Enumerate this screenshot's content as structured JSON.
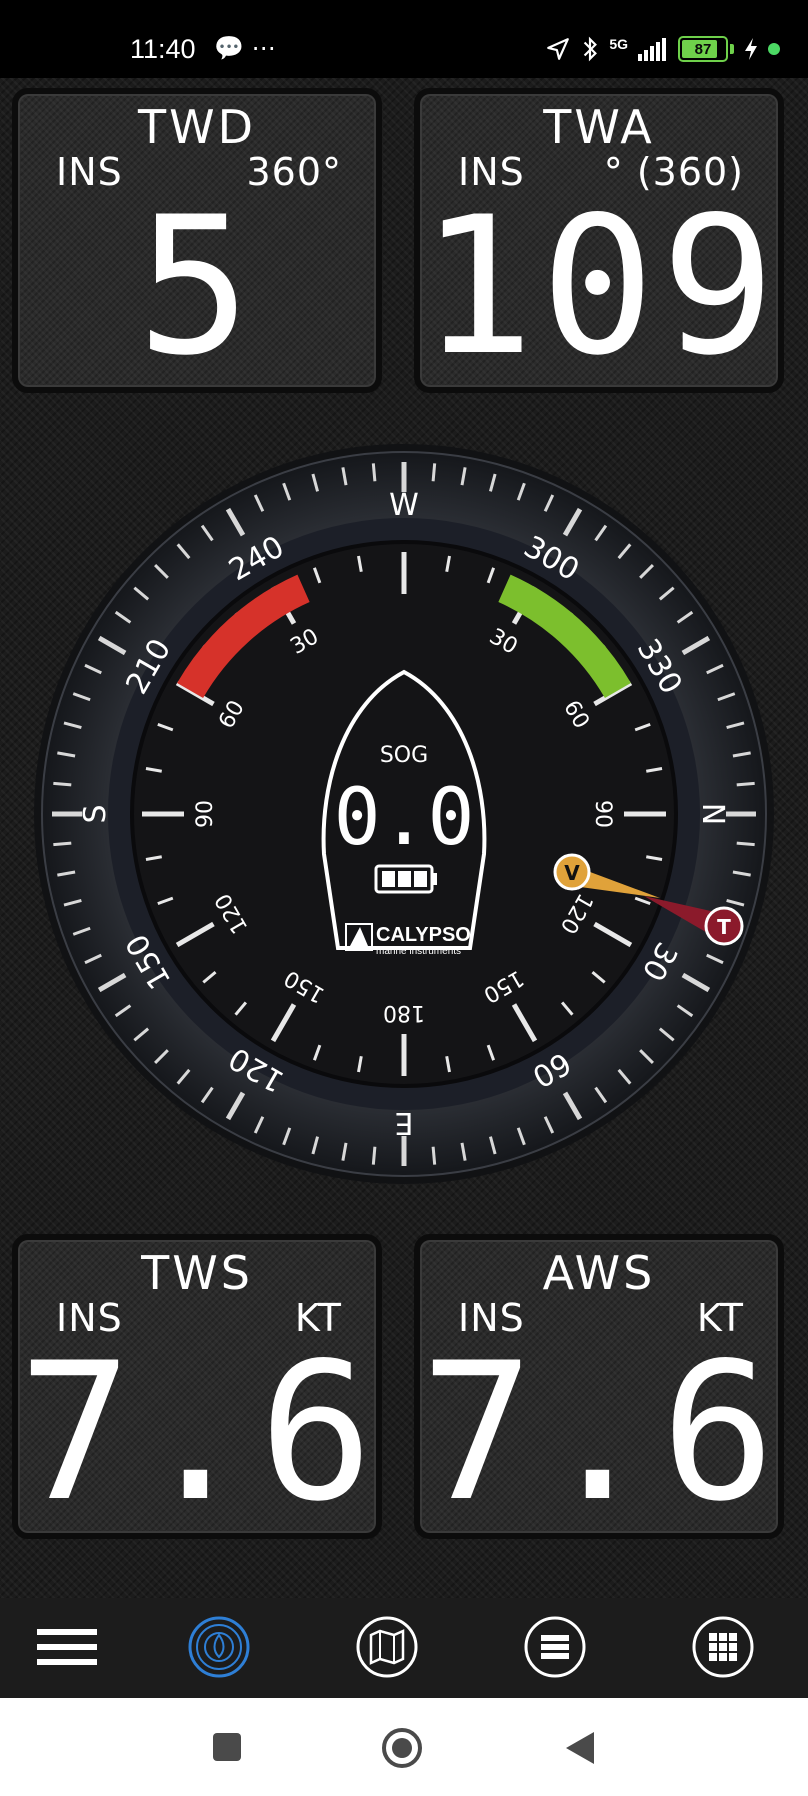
{
  "status_bar": {
    "time": "11:40",
    "left_icons": [
      "chat-bubble-icon",
      "more-dots-icon"
    ],
    "network": "5G",
    "battery": "87",
    "battery_level": 87
  },
  "tiles": {
    "twd": {
      "title": "TWD",
      "source": "INS",
      "unit": "360°",
      "value": "5"
    },
    "twa": {
      "title": "TWA",
      "source": "INS",
      "unit": "° (360)",
      "value": "109"
    },
    "tws": {
      "title": "TWS",
      "source": "INS",
      "unit": "KT",
      "value": "7.6"
    },
    "aws": {
      "title": "AWS",
      "source": "INS",
      "unit": "KT",
      "value": "7.6"
    }
  },
  "gauge": {
    "sog_label": "SOG",
    "sog_value": "0.0",
    "brand": "CALYPSO",
    "brand_sub": "marine instruments",
    "cardinals": {
      "top": "W",
      "right": "N",
      "bottom": "E",
      "left": "S"
    },
    "outer_labels": [
      "300",
      "330",
      "30",
      "60",
      "120",
      "150",
      "210",
      "240"
    ],
    "inner_labels": [
      "30",
      "60",
      "90",
      "120",
      "150",
      "180",
      "150",
      "120",
      "90",
      "60",
      "30"
    ],
    "apparent_marker": "V",
    "true_marker": "T",
    "colors": {
      "port": "#d6322a",
      "starboard": "#7cbf2d",
      "apparent": "#e0a23a",
      "true": "#8b1a2b"
    }
  },
  "nav": {
    "items": [
      "menu-icon",
      "compass-icon",
      "map-icon",
      "list-icon",
      "grid-icon"
    ],
    "active": 1
  }
}
